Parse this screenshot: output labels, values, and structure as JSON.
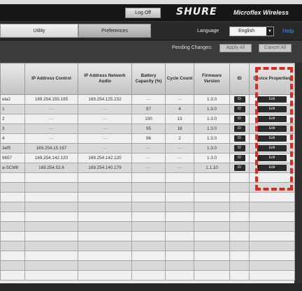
{
  "topbar": {
    "logoff_label": "Log Off",
    "brand": "SHURE",
    "product": "Microflex Wireless"
  },
  "tabs": [
    {
      "label": "Utility"
    },
    {
      "label": "Preferences"
    }
  ],
  "language": {
    "label": "Language",
    "value": "English",
    "arrow": "▼"
  },
  "help_label": "Help",
  "pending": {
    "label": "Pending Changes:",
    "apply_label": "Apply All",
    "cancel_label": "Cancel All"
  },
  "table": {
    "headers": [
      "",
      "IP Address Control",
      "IP Address Network Audio",
      "Battery Capacity (%)",
      "Cycle Count",
      "Firmware Version",
      "ID",
      "Device Properties"
    ],
    "rows": [
      {
        "name": "ela2",
        "ip_control": "169.254.155.195",
        "ip_audio": "169.254.125.232",
        "battery": "---",
        "cycle": "---",
        "firmware": "1.3.0",
        "id": "ID",
        "edit": "Edit"
      },
      {
        "name": "1",
        "ip_control": "---",
        "ip_audio": "---",
        "battery": "97",
        "cycle": "4",
        "firmware": "1.3.0",
        "id": "ID",
        "edit": "Edit"
      },
      {
        "name": "2",
        "ip_control": "---",
        "ip_audio": "---",
        "battery": "100",
        "cycle": "13",
        "firmware": "1.3.0",
        "id": "ID",
        "edit": "Edit"
      },
      {
        "name": "3",
        "ip_control": "---",
        "ip_audio": "---",
        "battery": "95",
        "cycle": "18",
        "firmware": "1.3.0",
        "id": "ID",
        "edit": "Edit"
      },
      {
        "name": "4",
        "ip_control": "---",
        "ip_audio": "---",
        "battery": "96",
        "cycle": "2",
        "firmware": "1.3.0",
        "id": "ID",
        "edit": "Edit"
      },
      {
        "name": "3ef5",
        "ip_control": "169.254.15.167",
        "ip_audio": "---",
        "battery": "---",
        "cycle": "---",
        "firmware": "1.3.0",
        "id": "ID",
        "edit": "Edit"
      },
      {
        "name": "9657",
        "ip_control": "169.254.142.120",
        "ip_audio": "169.254.142.120",
        "battery": "---",
        "cycle": "---",
        "firmware": "1.3.0",
        "id": "ID",
        "edit": "Edit"
      },
      {
        "name": "a-SCM8",
        "ip_control": "169.254.53.6",
        "ip_audio": "169.254.140.179",
        "battery": "---",
        "cycle": "---",
        "firmware": "1.1.10",
        "id": "ID",
        "edit": "Edit"
      }
    ]
  }
}
